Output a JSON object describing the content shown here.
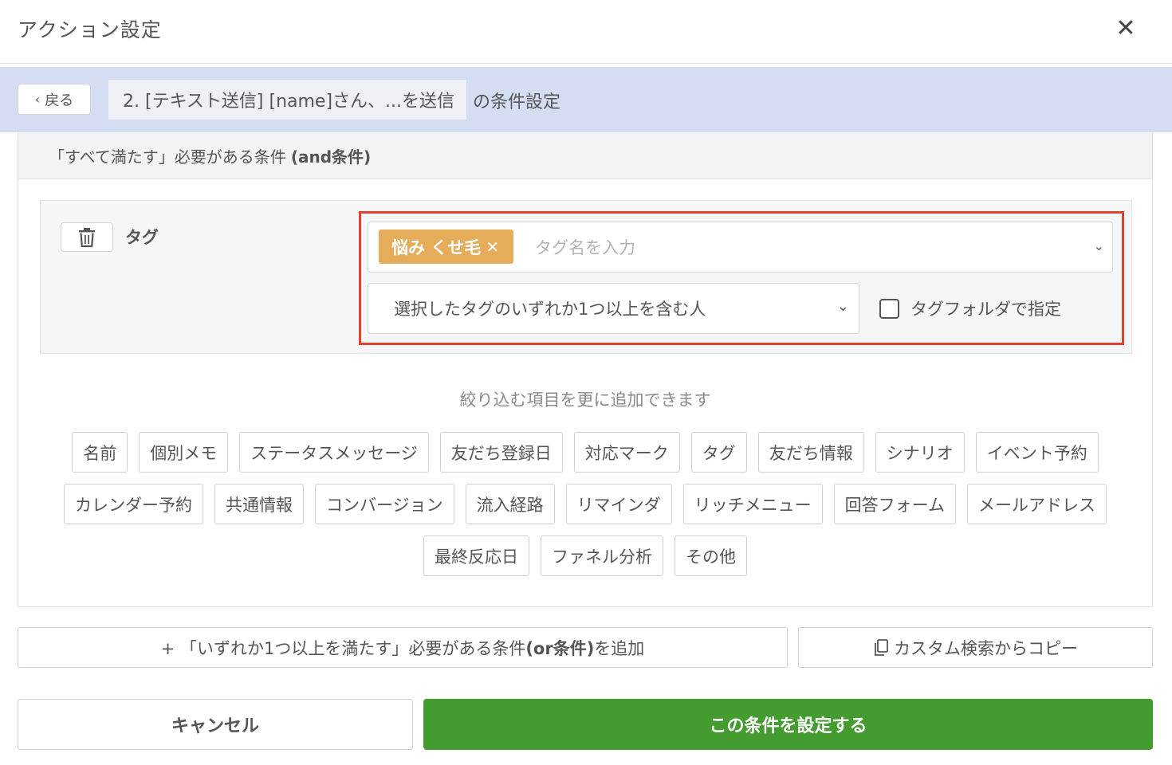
{
  "header": {
    "title": "アクション設定",
    "close_label": "✕"
  },
  "subbar": {
    "back_label": "戻る",
    "action_name": "2. [テキスト送信] [name]さん、...を送信",
    "suffix": "の条件設定"
  },
  "panel": {
    "heading": "「すべて満たす」必要がある条件",
    "heading_bold": "(and条件)",
    "condition": {
      "label": "タグ",
      "selected_tags": [
        "悩み くせ毛"
      ],
      "tag_input_placeholder": "タグ名を入力",
      "match_mode": "選択したタグのいずれか1つ以上を含む人",
      "folder_checkbox_label": "タグフォルダで指定",
      "folder_checked": false
    },
    "hint": "絞り込む項目を更に追加できます",
    "filter_items": [
      [
        "名前",
        "個別メモ",
        "ステータスメッセージ",
        "友だち登録日",
        "対応マーク",
        "タグ",
        "友だち情報",
        "シナリオ",
        "イベント予約"
      ],
      [
        "カレンダー予約",
        "共通情報",
        "コンバージョン",
        "流入経路",
        "リマインダ",
        "リッチメニュー",
        "回答フォーム",
        "メールアドレス"
      ],
      [
        "最終反応日",
        "ファネル分析",
        "その他"
      ]
    ]
  },
  "actions": {
    "or_prefix": "+ 「いずれか1つ以上を満たす」必要がある条件",
    "or_bold": "(or条件)",
    "or_suffix": "を追加",
    "copy_label": "カスタム検索からコピー",
    "cancel_label": "キャンセル",
    "submit_label": "この条件を設定する"
  },
  "colors": {
    "subbar_bg": "#d5ddf3",
    "tag_chip": "#e5ac5a",
    "highlight_border": "#e2422d",
    "submit_bg": "#449b30"
  },
  "icons": [
    "close-icon",
    "chevron-left-icon",
    "trash-icon",
    "chip-remove-icon",
    "chevron-down-icon",
    "copy-icon"
  ]
}
